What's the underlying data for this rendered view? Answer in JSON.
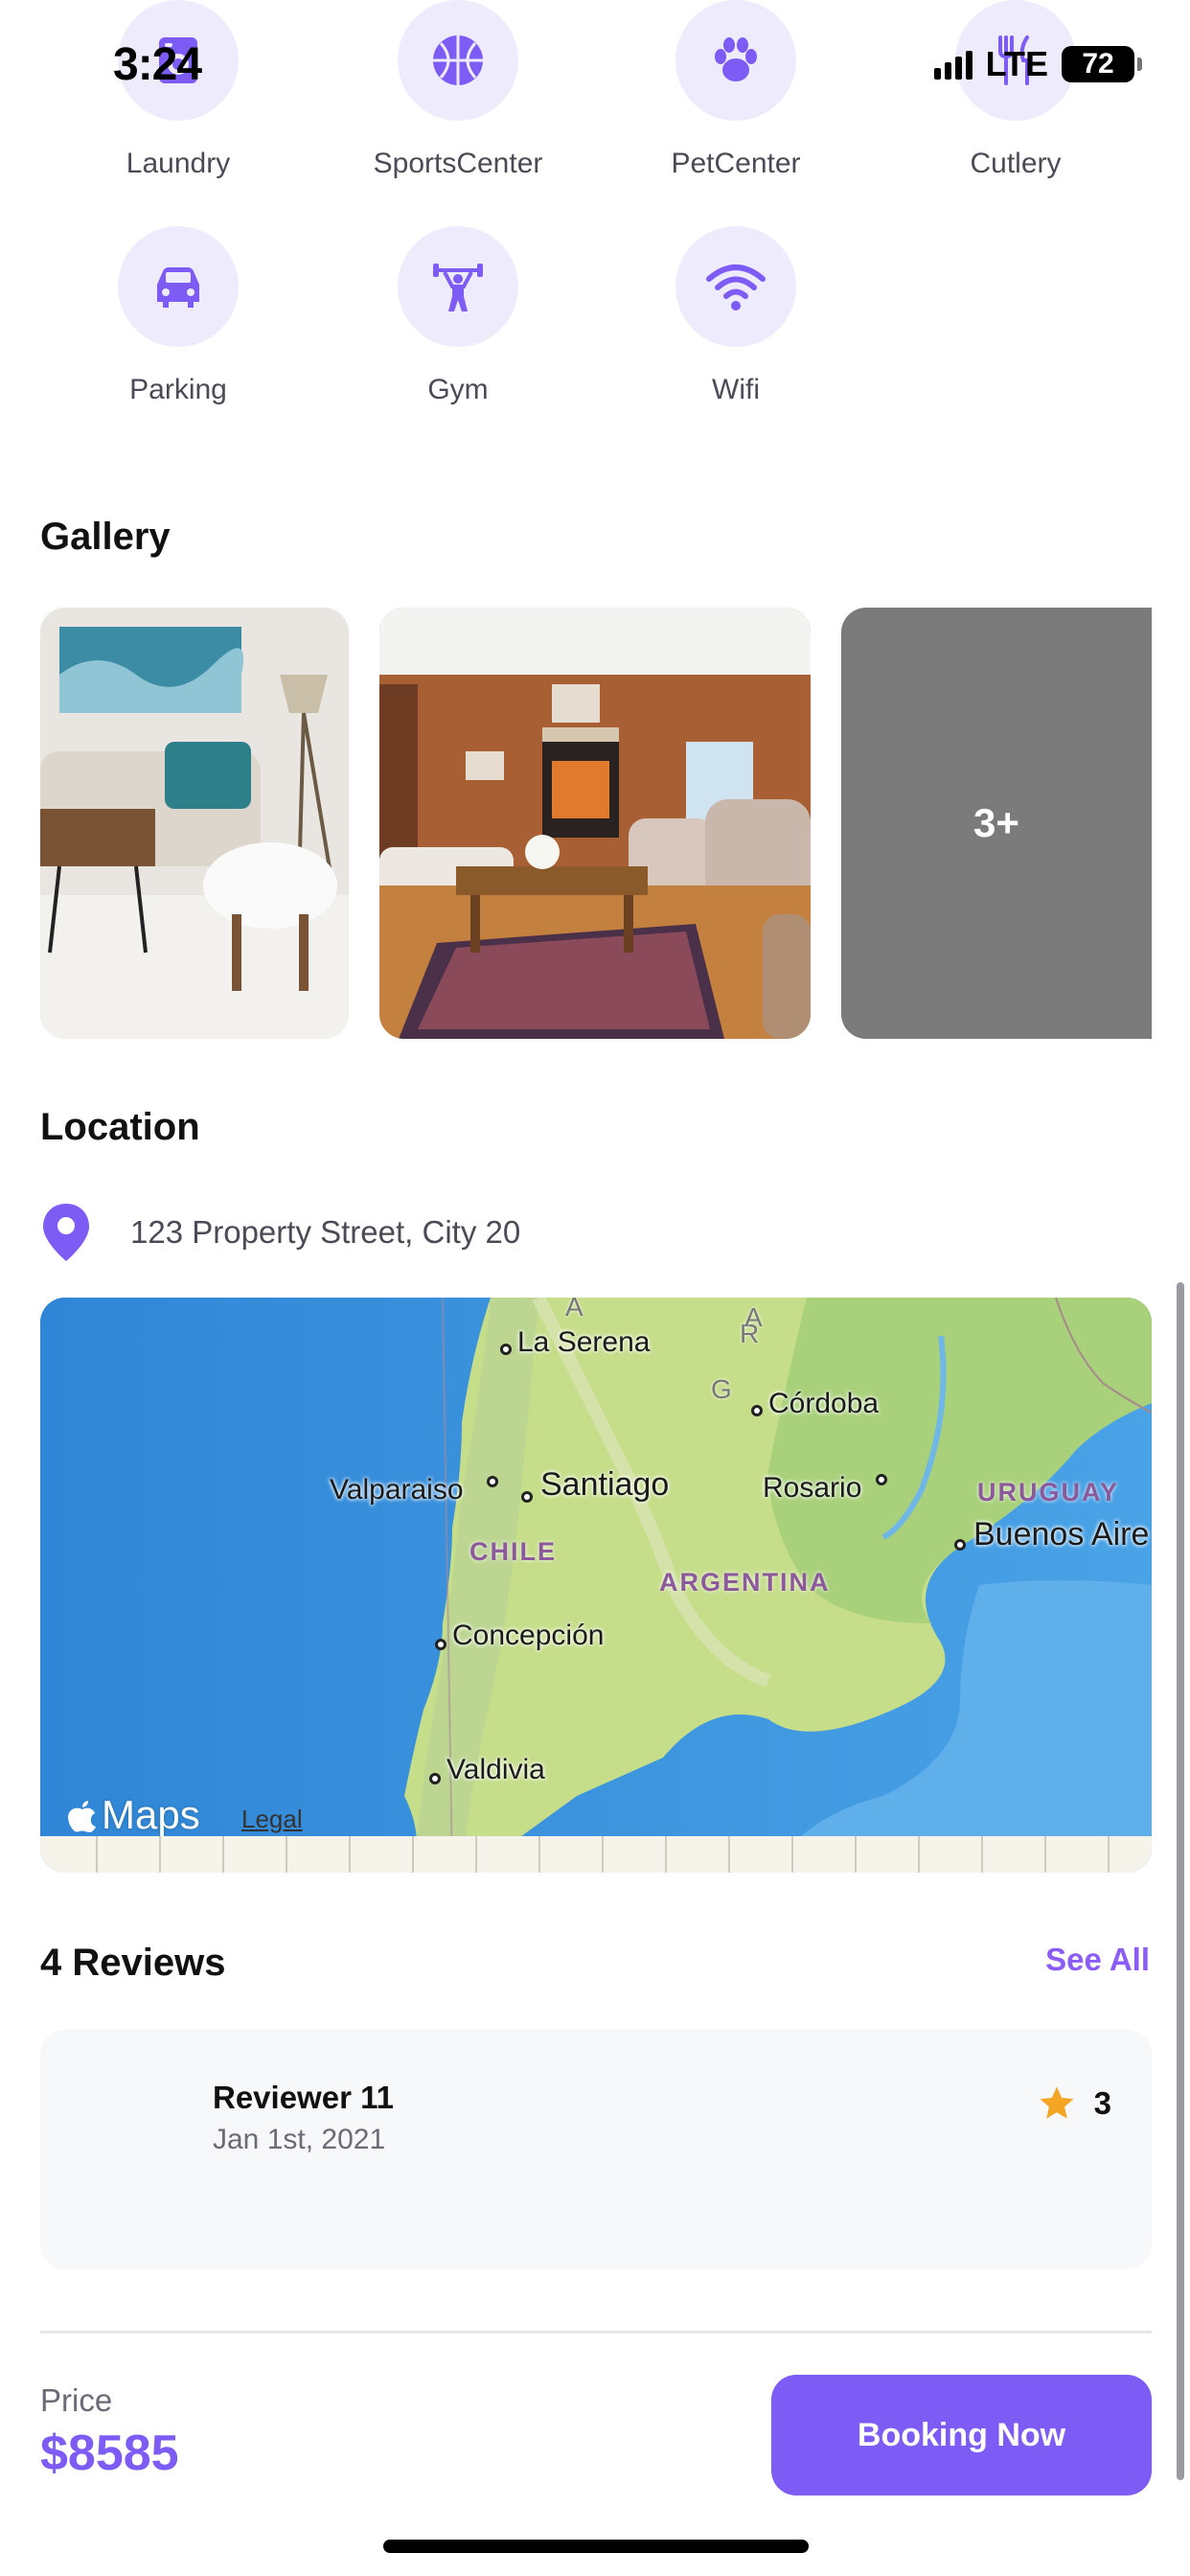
{
  "status_bar": {
    "time": "3:24",
    "network": "LTE",
    "battery": "72"
  },
  "amenities": [
    {
      "label": "Laundry",
      "icon": "laundry-icon"
    },
    {
      "label": "SportsCenter",
      "icon": "basketball-icon"
    },
    {
      "label": "PetCenter",
      "icon": "paw-icon"
    },
    {
      "label": "Cutlery",
      "icon": "cutlery-icon"
    },
    {
      "label": "Parking",
      "icon": "car-icon"
    },
    {
      "label": "Gym",
      "icon": "weightlifter-icon"
    },
    {
      "label": "Wifi",
      "icon": "wifi-icon"
    }
  ],
  "gallery": {
    "title": "Gallery",
    "more_label": "3+",
    "images": [
      "living-room-photo",
      "wood-paneled-living-room-photo"
    ]
  },
  "location": {
    "title": "Location",
    "address": "123 Property Street, City 20",
    "map": {
      "brand": "Maps",
      "legal": "Legal",
      "labels": {
        "la_serena": "La Serena",
        "cordoba": "Córdoba",
        "valparaiso": "Valparaiso",
        "santiago": "Santiago",
        "rosario": "Rosario",
        "uruguay": "URUGUAY",
        "buenos_aires": "Buenos Aire",
        "chile": "CHILE",
        "argentina": "ARGENTINA",
        "concepcion": "Concepción",
        "valdivia": "Valdivia",
        "range_a": "A",
        "range_r": "R",
        "range_g": "G",
        "range_a2": "A"
      }
    }
  },
  "reviews": {
    "title": "4 Reviews",
    "see_all": "See All",
    "items": [
      {
        "name": "Reviewer 11",
        "date": "Jan 1st, 2021",
        "rating": "3"
      }
    ]
  },
  "footer": {
    "price_label": "Price",
    "price_value": "$8585",
    "booking_button": "Booking Now"
  },
  "colors": {
    "accent": "#7c5cf5",
    "accent_light": "#eeebfd",
    "star": "#f5a524"
  }
}
